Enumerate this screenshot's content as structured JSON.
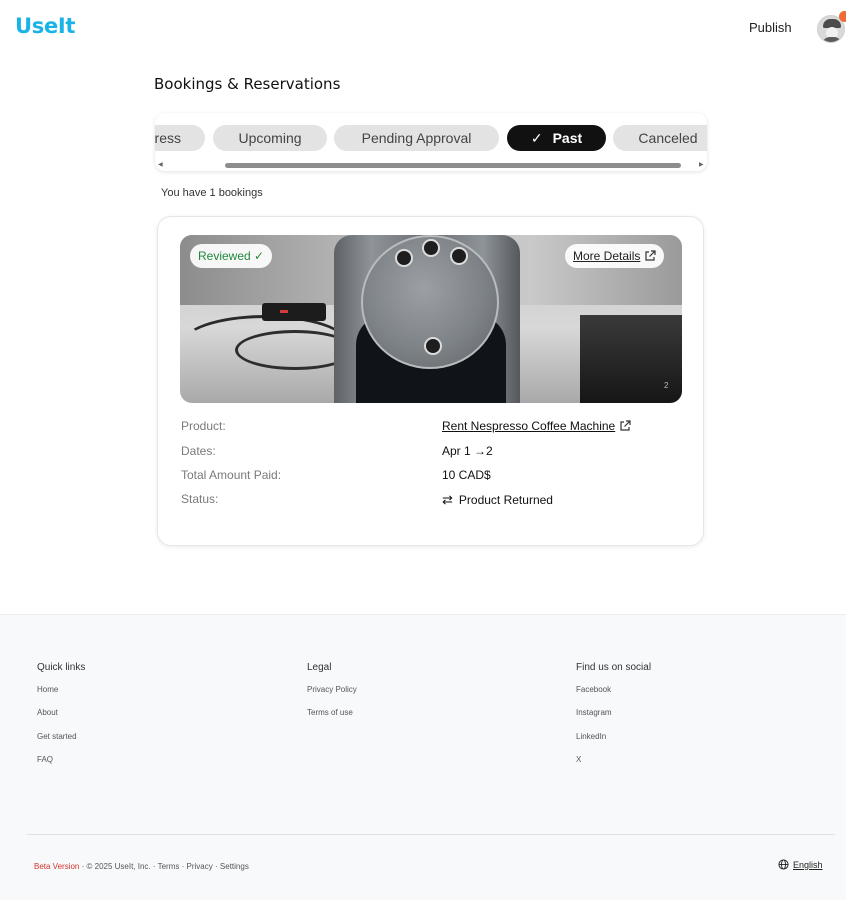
{
  "header": {
    "logo": "UseIt",
    "publish": "Publish"
  },
  "page": {
    "title": "Bookings & Reservations",
    "tabs": [
      {
        "label": "ress",
        "active": false
      },
      {
        "label": "Upcoming",
        "active": false
      },
      {
        "label": "Pending Approval",
        "active": false
      },
      {
        "label": "Past",
        "active": true
      },
      {
        "label": "Canceled",
        "active": false
      }
    ],
    "bookings_count": "You have 1 bookings"
  },
  "booking": {
    "badge": "Reviewed ✓",
    "more_details": "More Details",
    "photo_counter": "2",
    "product_label": "Product:",
    "product_value": "Rent Nespresso Coffee Machine",
    "dates_label": "Dates:",
    "dates_value": "Apr 1 →2",
    "total_label": "Total Amount Paid:",
    "total_value": "10 CAD$",
    "status_label": "Status:",
    "status_value": "Product Returned",
    "status_icon": "swap-arrows-icon"
  },
  "footer": {
    "quick_links": {
      "heading": "Quick links",
      "items": [
        "Home",
        "About",
        "Get started",
        "FAQ"
      ]
    },
    "legal": {
      "heading": "Legal",
      "items": [
        "Privacy Policy",
        "Terms of use"
      ]
    },
    "social": {
      "heading": "Find us on social",
      "items": [
        "Facebook",
        "Instagram",
        "LinkedIn",
        "X"
      ]
    },
    "bottom": {
      "beta": "Beta Version",
      "copyright": "· © 2025 UseIt, Inc. ·",
      "terms": "Terms",
      "privacy": "Privacy",
      "settings": "Settings",
      "sep": "·"
    },
    "language": "English"
  },
  "colors": {
    "brand": "#1ab3e8",
    "active_tab": "#111111",
    "reviewed": "#1f8a3c",
    "beta": "#d0342c"
  }
}
